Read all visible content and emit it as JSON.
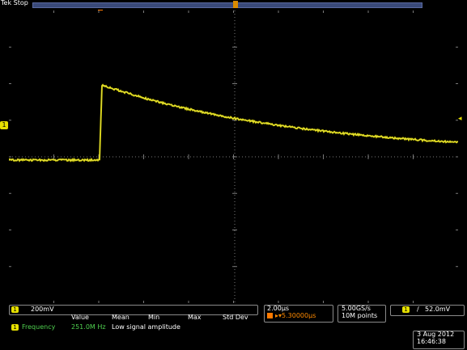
{
  "status": {
    "mode": "Tek Stop"
  },
  "channel": {
    "badge": "1",
    "scale": "200mV",
    "marker": "1"
  },
  "measurements": {
    "headers": {
      "value": "Value",
      "mean": "Mean",
      "min": "Min",
      "max": "Max",
      "std": "Std Dev"
    },
    "row": {
      "badge": "1",
      "name": "Frequency",
      "value": "251.0M Hz",
      "note": "Low signal amplitude"
    }
  },
  "horizontal": {
    "scale": "2.00µs",
    "position": "▸▾5.30000µs"
  },
  "acquisition": {
    "sample_rate": "5.00GS/s",
    "record_length": "10M points"
  },
  "trigger": {
    "badge": "1",
    "slope": "/",
    "level": "52.0mV"
  },
  "datetime": {
    "date": "3 Aug 2012",
    "time": "16:46:38"
  },
  "colors": {
    "trace": "#e6e000",
    "grid": "#7a7a7a",
    "accent": "#ff7a00"
  },
  "icons": {
    "trigger_position": "trigger-position-marker",
    "channel": "channel-1-ground-marker",
    "trigger_level": "trigger-level-arrow"
  }
}
